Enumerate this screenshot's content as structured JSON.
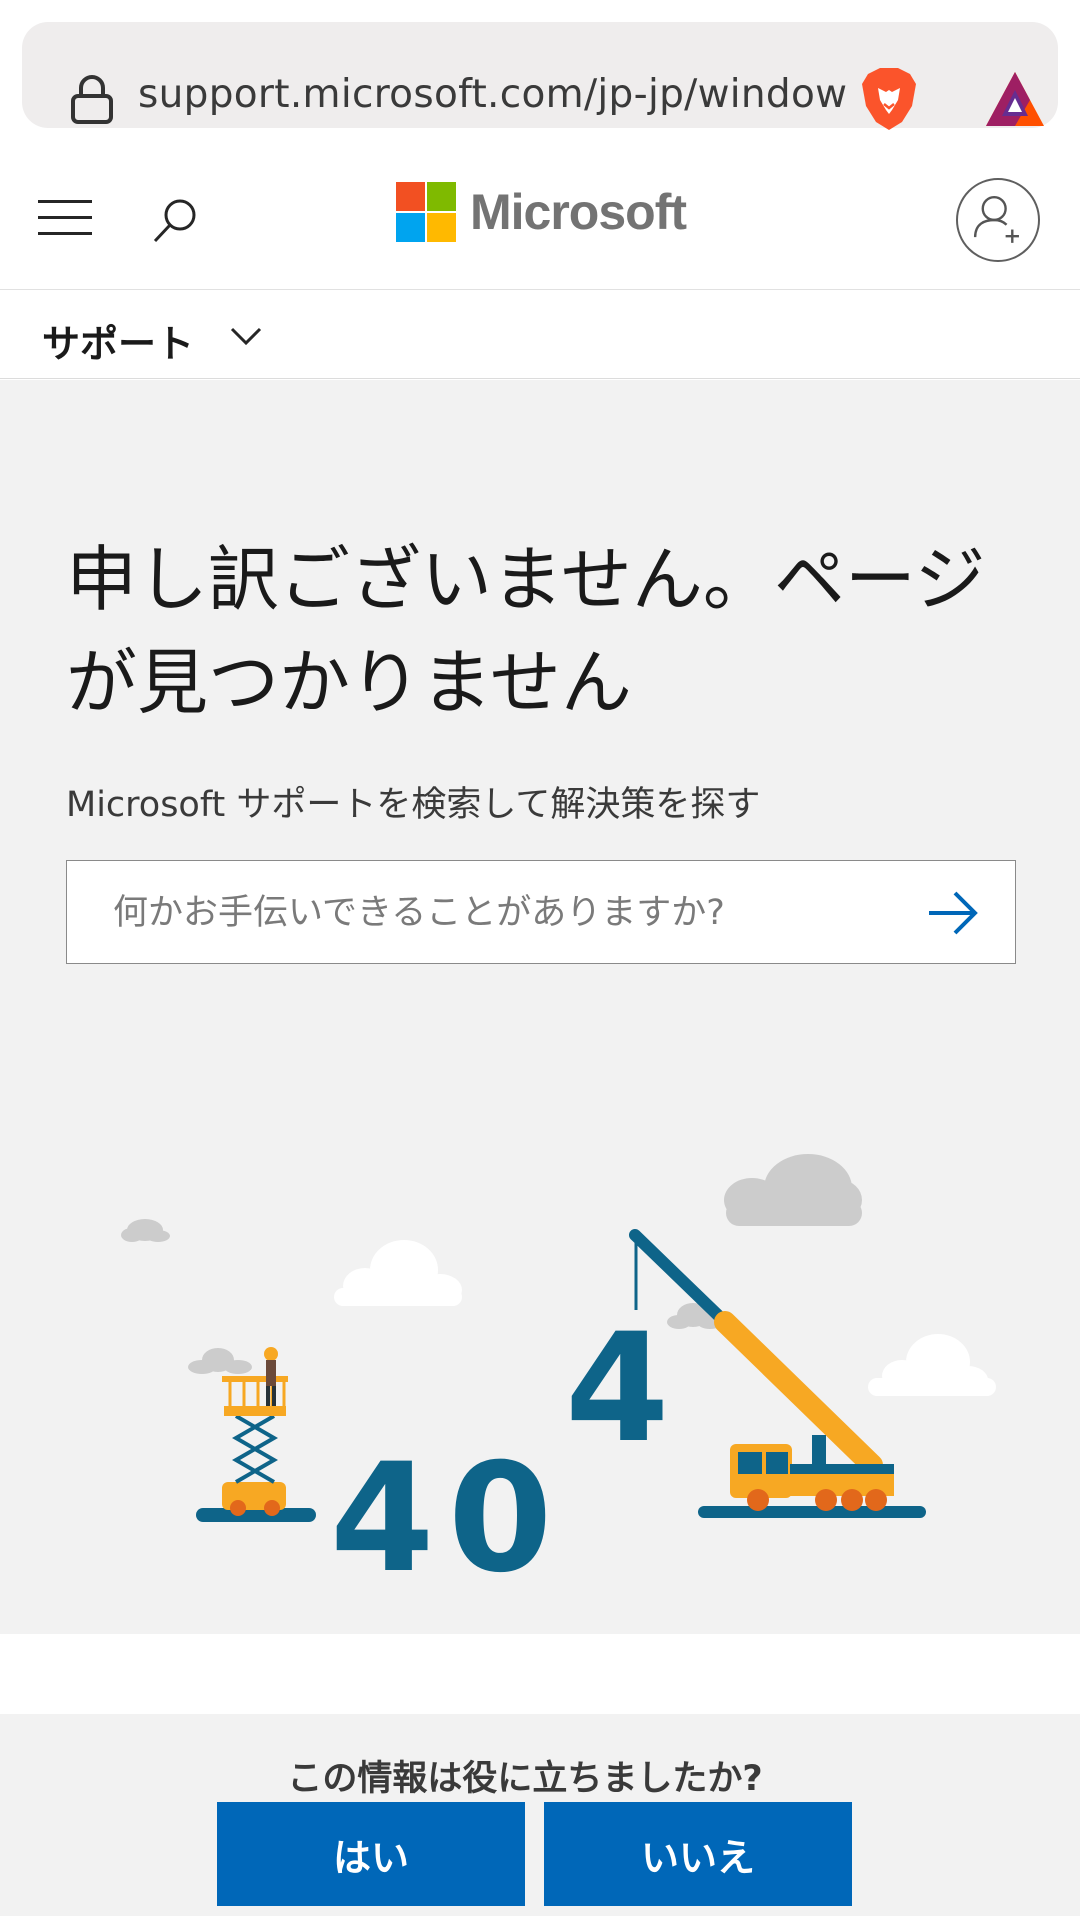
{
  "browser": {
    "url": "support.microsoft.com/jp-jp/window",
    "icons": [
      "lock-icon",
      "brave-lion-icon",
      "bat-triangle-icon"
    ]
  },
  "header": {
    "brand": "Microsoft",
    "brand_colors": [
      "#f25022",
      "#7fba00",
      "#00a4ef",
      "#ffb900"
    ],
    "icons": [
      "hamburger-menu-icon",
      "search-icon",
      "account-add-icon"
    ]
  },
  "nav": {
    "support_label": "サポート"
  },
  "main": {
    "error_title": "申し訳ございません。ページが見つかりません",
    "search_hint": "Microsoft サポートを検索して解決策を探す",
    "search_placeholder": "何かお手伝いできることがありますか?",
    "illustration_text": [
      "4",
      "0",
      "4"
    ],
    "illustration_color": "#0e6489",
    "accent_orange": "#f7a823"
  },
  "feedback": {
    "question": "この情報は役に立ちましたか?",
    "yes_label": "はい",
    "no_label": "いいえ",
    "button_color": "#0067b8"
  }
}
